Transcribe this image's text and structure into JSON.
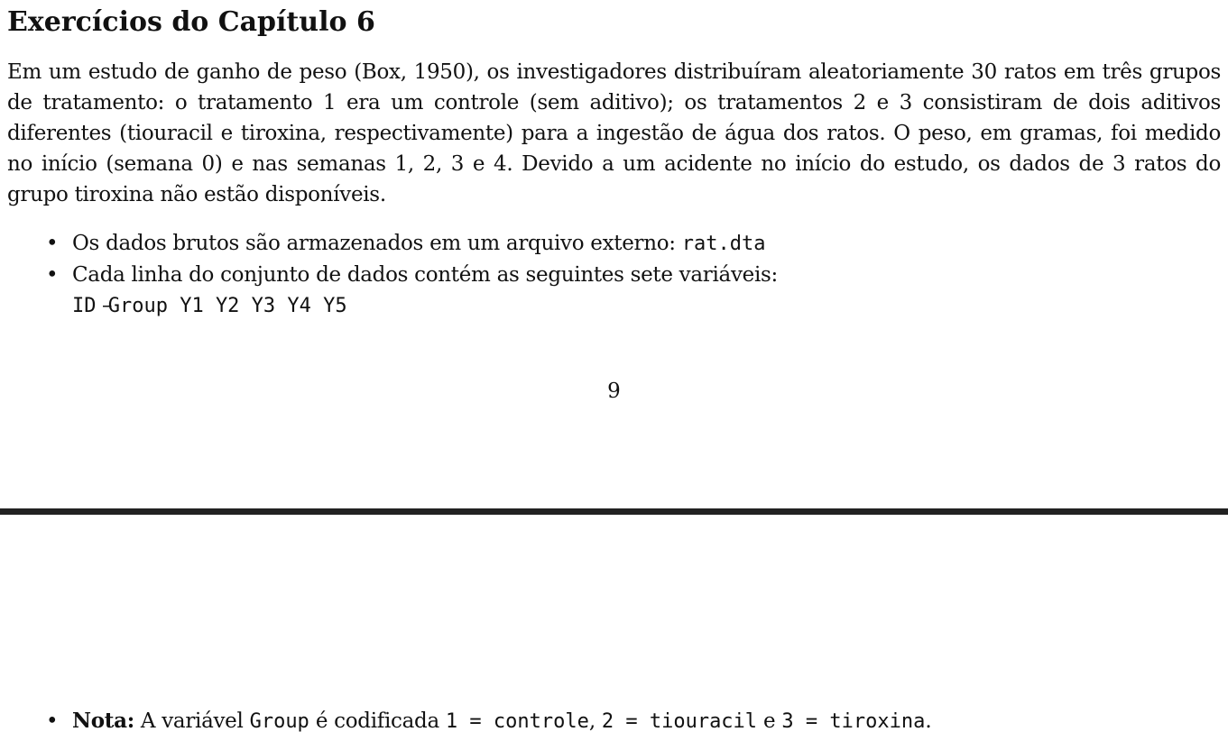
{
  "heading": "Exercícios do Capítulo 6",
  "intro_paragraph": "Em um estudo de ganho de peso (Box, 1950), os investigadores distribuíram aleatoriamente 30 ratos em três grupos de tratamento: o tratamento 1 era um controle (sem aditivo); os tratamentos 2 e 3 consistiram de dois aditivos diferentes (tiouracil e tiroxina, respectivamente) para a ingestão de água dos ratos. O peso, em gramas, foi medido no início (semana 0) e nas semanas 1, 2, 3 e 4. Devido a um acidente no início do estudo, os dados de 3 ratos do grupo tiroxina não estão disponíveis.",
  "bullets": {
    "raw_data_text": "Os dados brutos são armazenados em um arquivo externo: ",
    "raw_data_file": "rat.dta",
    "row_text": "Cada linha do conjunto de dados contém as seguintes sete variáveis:",
    "variables": "ID Group Y1 Y2 Y3 Y4 Y5"
  },
  "bullet_symbol": "•",
  "dash_symbol": "–",
  "page_number": "9",
  "note": {
    "label": "Nota:",
    "text1": " A variável ",
    "var": "Group",
    "text2": " é codificada ",
    "code1": "1 = controle",
    "sep1": ", ",
    "code2": "2 = tiouracil",
    "sep2": " e ",
    "code3": "3 = tiroxina",
    "end": "."
  }
}
